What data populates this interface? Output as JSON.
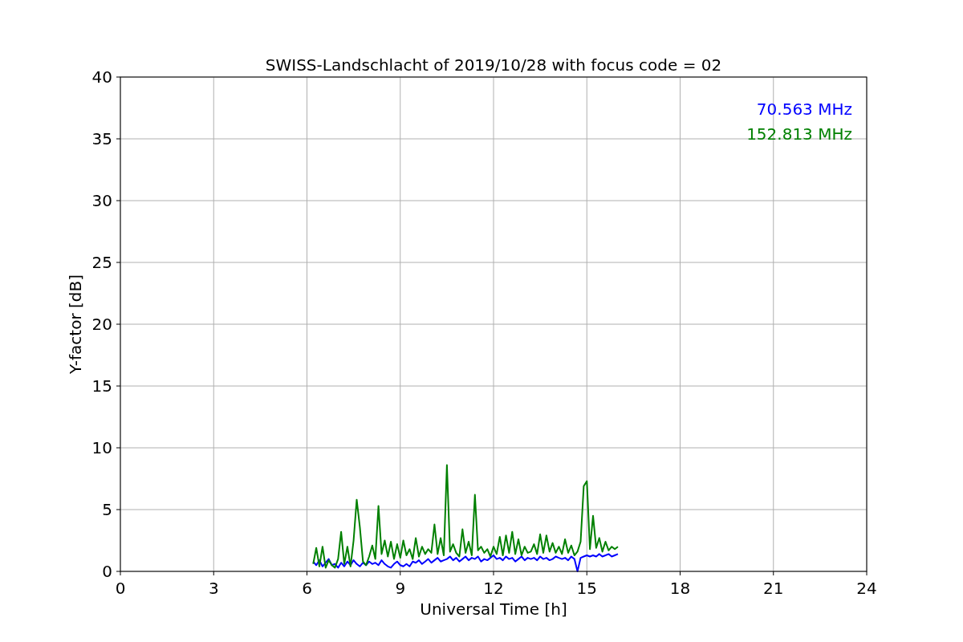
{
  "chart_data": {
    "type": "line",
    "title": "SWISS-Landschlacht of 2019/10/28 with focus code = 02",
    "xlabel": "Universal Time [h]",
    "ylabel": "Y-factor [dB]",
    "x": [
      6.2,
      6.3,
      6.4,
      6.5,
      6.6,
      6.7,
      6.8,
      6.9,
      7.0,
      7.1,
      7.2,
      7.3,
      7.4,
      7.5,
      7.6,
      7.7,
      7.8,
      7.9,
      8.0,
      8.1,
      8.2,
      8.3,
      8.4,
      8.5,
      8.6,
      8.7,
      8.8,
      8.9,
      9.0,
      9.1,
      9.2,
      9.3,
      9.4,
      9.5,
      9.6,
      9.7,
      9.8,
      9.9,
      10.0,
      10.1,
      10.2,
      10.3,
      10.4,
      10.5,
      10.6,
      10.7,
      10.8,
      10.9,
      11.0,
      11.1,
      11.2,
      11.3,
      11.4,
      11.5,
      11.6,
      11.7,
      11.8,
      11.9,
      12.0,
      12.1,
      12.2,
      12.3,
      12.4,
      12.5,
      12.6,
      12.7,
      12.8,
      12.9,
      13.0,
      13.1,
      13.2,
      13.3,
      13.4,
      13.5,
      13.6,
      13.7,
      13.8,
      13.9,
      14.0,
      14.1,
      14.2,
      14.3,
      14.4,
      14.5,
      14.6,
      14.7,
      14.8,
      14.9,
      15.0,
      15.1,
      15.2,
      15.3,
      15.4,
      15.5,
      15.6,
      15.7,
      15.8,
      15.9,
      16.0
    ],
    "series": [
      {
        "name": "70.563 MHz",
        "color": "#0000ff",
        "values": [
          0.8,
          0.5,
          0.9,
          0.4,
          0.7,
          1.0,
          0.5,
          0.6,
          0.3,
          0.7,
          0.4,
          0.8,
          0.5,
          0.9,
          0.6,
          0.4,
          0.7,
          0.5,
          0.8,
          0.6,
          0.7,
          0.5,
          0.9,
          0.6,
          0.4,
          0.3,
          0.6,
          0.8,
          0.5,
          0.4,
          0.6,
          0.4,
          0.8,
          0.7,
          0.9,
          0.6,
          0.8,
          1.0,
          0.7,
          0.9,
          1.1,
          0.8,
          0.9,
          1.0,
          1.2,
          0.9,
          1.1,
          0.8,
          1.0,
          1.2,
          0.9,
          1.1,
          1.0,
          1.2,
          0.8,
          1.0,
          0.9,
          1.1,
          1.3,
          1.0,
          1.1,
          0.9,
          1.2,
          1.0,
          1.1,
          0.8,
          1.0,
          1.2,
          0.9,
          1.1,
          1.0,
          1.1,
          0.9,
          1.2,
          1.0,
          1.1,
          0.9,
          1.0,
          1.2,
          1.1,
          1.0,
          1.1,
          0.9,
          1.2,
          1.0,
          0.0,
          1.1,
          1.2,
          1.3,
          1.2,
          1.3,
          1.2,
          1.4,
          1.2,
          1.3,
          1.4,
          1.2,
          1.3,
          1.4
        ]
      },
      {
        "name": "152.813 MHz",
        "color": "#008000",
        "values": [
          0.6,
          1.9,
          0.4,
          2.0,
          0.3,
          0.9,
          0.5,
          0.3,
          1.0,
          3.2,
          0.6,
          2.0,
          0.4,
          2.5,
          5.8,
          3.6,
          0.8,
          0.5,
          1.2,
          2.1,
          1.0,
          5.3,
          1.4,
          2.5,
          1.2,
          2.4,
          1.0,
          2.2,
          1.1,
          2.5,
          1.3,
          1.8,
          1.0,
          2.7,
          1.2,
          2.0,
          1.4,
          1.8,
          1.5,
          3.8,
          1.4,
          2.7,
          1.3,
          8.6,
          1.6,
          2.2,
          1.5,
          1.2,
          3.4,
          1.5,
          2.4,
          1.3,
          6.2,
          1.7,
          2.0,
          1.5,
          1.8,
          1.2,
          2.0,
          1.4,
          2.8,
          1.3,
          2.9,
          1.5,
          3.2,
          1.4,
          2.6,
          1.3,
          2.0,
          1.5,
          1.6,
          2.2,
          1.4,
          3.0,
          1.5,
          2.9,
          1.6,
          2.3,
          1.5,
          2.0,
          1.4,
          2.6,
          1.5,
          2.1,
          1.3,
          1.6,
          2.4,
          6.9,
          7.3,
          1.8,
          4.5,
          1.9,
          2.7,
          1.6,
          2.4,
          1.7,
          2.0,
          1.8,
          2.0
        ]
      }
    ],
    "xlim": [
      0,
      24
    ],
    "ylim": [
      0,
      40
    ],
    "xticks": [
      0,
      3,
      6,
      9,
      12,
      15,
      18,
      21,
      24
    ],
    "yticks": [
      0,
      5,
      10,
      15,
      20,
      25,
      30,
      35,
      40
    ],
    "grid": true
  }
}
